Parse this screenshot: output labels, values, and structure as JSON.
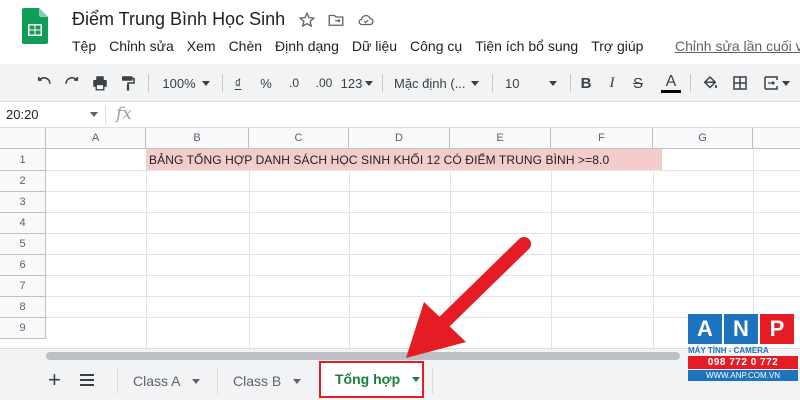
{
  "app": {
    "doc_title": "Điểm Trung Bình Học Sinh",
    "menu": [
      "Tệp",
      "Chỉnh sửa",
      "Xem",
      "Chèn",
      "Định dạng",
      "Dữ liệu",
      "Công cụ",
      "Tiện ích bổ sung",
      "Trợ giúp"
    ],
    "last_edit": "Chỉnh sửa lần cuối v"
  },
  "toolbar": {
    "zoom": "100%",
    "currency": "₫",
    "percent": "%",
    "dec_decrease": ".0",
    "dec_increase": ".00",
    "more_formats": "123",
    "font": "Mặc định (...",
    "font_size": "10",
    "bold": "B",
    "italic": "I",
    "strike": "S",
    "text_color": "A"
  },
  "formula_bar": {
    "name_box": "20:20",
    "fx": "fx"
  },
  "grid": {
    "columns": [
      "A",
      "B",
      "C",
      "D",
      "E",
      "F",
      "G"
    ],
    "rows": [
      "1",
      "2",
      "3",
      "4",
      "5",
      "6",
      "7",
      "8",
      "9"
    ],
    "title_cell": "BẢNG TỔNG HỢP DANH SÁCH HỌC SINH KHỐI 12 CÓ ĐIỂM TRUNG BÌNH >=8.0"
  },
  "sheets": {
    "add": "+",
    "tabs": [
      {
        "label": "Class A",
        "active": false
      },
      {
        "label": "Class B",
        "active": false
      },
      {
        "label": "Tổng hợp",
        "active": true
      }
    ]
  },
  "watermark": {
    "letters": [
      "A",
      "N",
      "P"
    ],
    "tagline": "MÁY TÍNH - CAMERA",
    "phone": "098 772 0 772",
    "web": "WWW.ANP.COM.VN"
  },
  "colors": {
    "accent_green": "#188038",
    "highlight_red": "#e51c23",
    "title_fill": "#f4cccc",
    "anp_blue": "#1e73be"
  }
}
